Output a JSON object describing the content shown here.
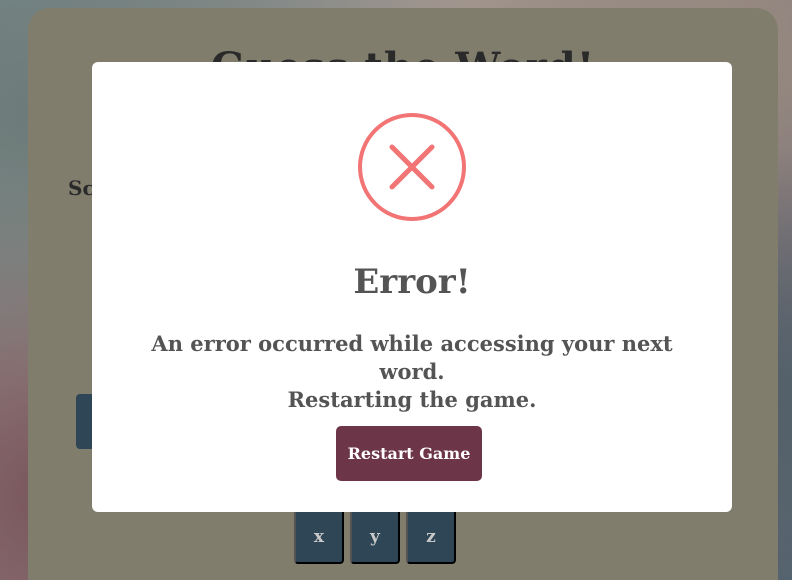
{
  "game": {
    "title": "Guess the Word!",
    "score_label": "Sc",
    "keys": [
      "x",
      "y",
      "z"
    ]
  },
  "modal": {
    "icon": "error-x-icon",
    "title": "Error!",
    "message_line1": "An error occurred while accessing your next word.",
    "message_line2": "Restarting the game.",
    "button_label": "Restart Game"
  },
  "colors": {
    "card": "#817d6d",
    "key": "#2f4656",
    "error": "#f27474",
    "button": "#6d3548",
    "text": "#545454"
  }
}
